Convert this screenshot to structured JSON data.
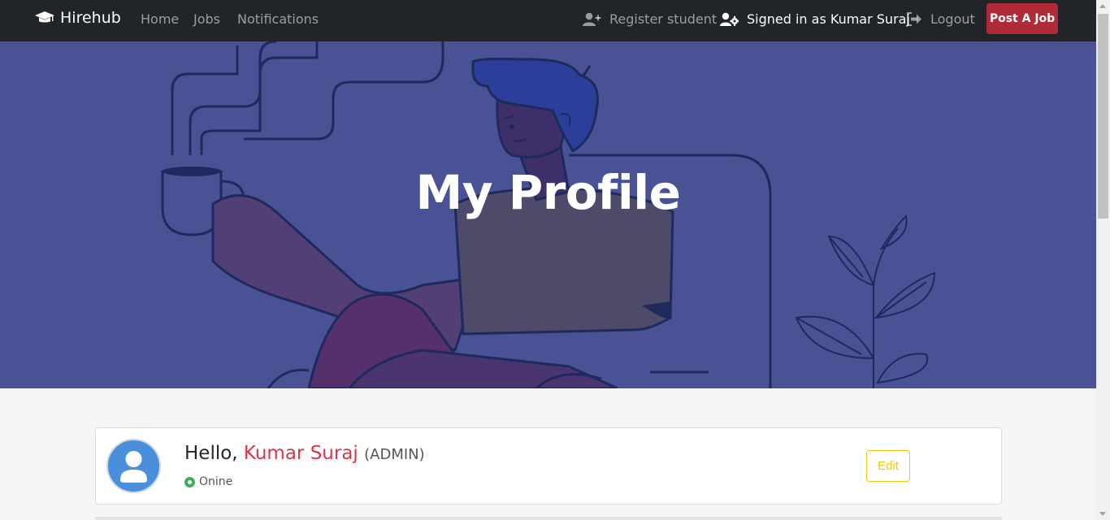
{
  "navbar": {
    "brand": "Hirehub",
    "links": [
      "Home",
      "Jobs",
      "Notifications"
    ],
    "register_label": "Register student",
    "signed_in_label": "Signed in as Kumar Suraj",
    "logout_label": "Logout",
    "post_job_label": "Post A Job"
  },
  "hero": {
    "title": "My Profile"
  },
  "profile": {
    "greeting": "Hello,",
    "name": "Kumar Suraj",
    "role": "(ADMIN)",
    "status": "Onine",
    "edit_label": "Edit"
  },
  "colors": {
    "navbar_bg": "#212529",
    "hero_bg": "#4a5296",
    "accent_red": "#dc3545",
    "edit_yellow": "#ffc107",
    "status_green": "#3fae5c"
  }
}
